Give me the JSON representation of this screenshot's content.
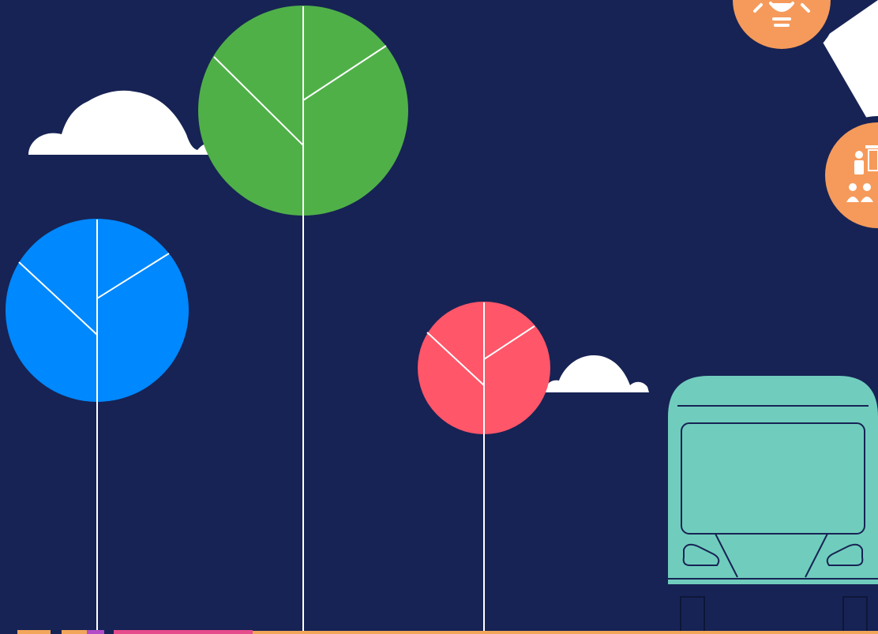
{
  "scene": {
    "background": "#172354",
    "line_color": "#FFFFFF",
    "trees": [
      {
        "name": "tree-blue",
        "color": "#0088FF"
      },
      {
        "name": "tree-green",
        "color": "#4FB048"
      },
      {
        "name": "tree-red",
        "color": "#FF5669"
      }
    ],
    "clouds_color": "#FFFFFF",
    "bus": {
      "body_color": "#70CDBD",
      "outline_color": "#172354"
    },
    "icons": [
      {
        "name": "lightbulb-icon",
        "badge_color": "#F59A5B"
      },
      {
        "name": "presentation-icon",
        "badge_color": "#F59A5B"
      }
    ],
    "bottom_strip_colors": [
      "#F2A65A",
      "#F2A65A",
      "#B44CC8",
      "#E64C8C",
      "#F2A65A"
    ]
  }
}
